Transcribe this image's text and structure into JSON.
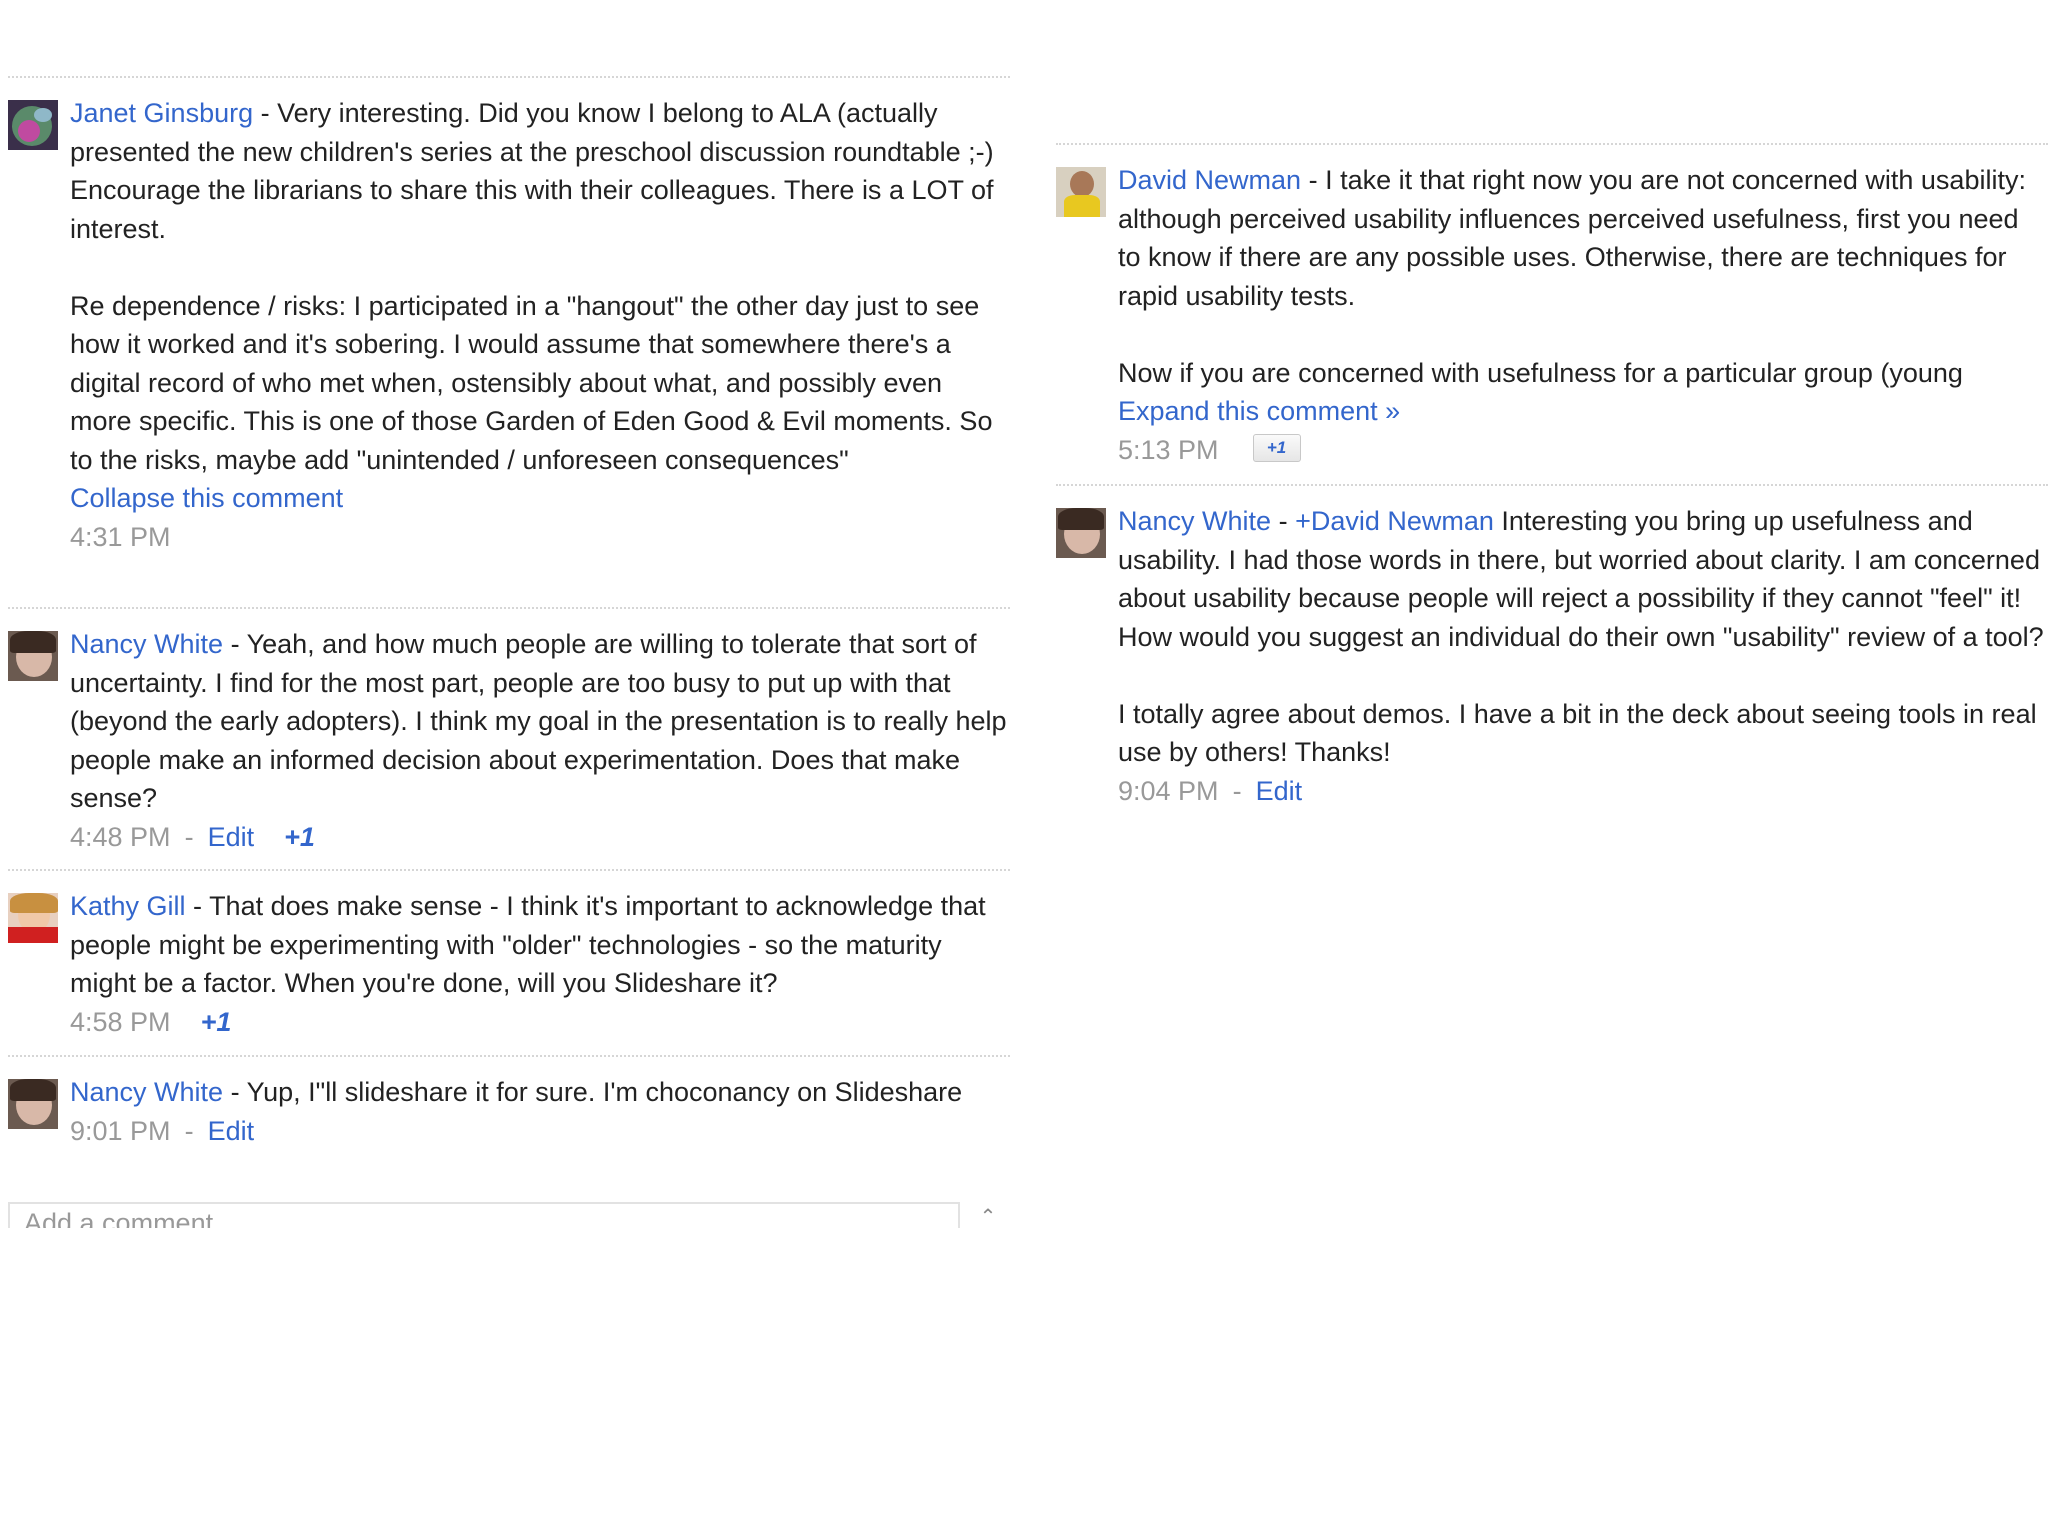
{
  "left_column": {
    "comments": [
      {
        "author": "Janet Ginsburg",
        "separator": " - ",
        "paragraphs": [
          "Very interesting. Did you know I belong to ALA (actually presented the new children's series at the preschool discussion roundtable ;-) Encourage the librarians to share this with their colleagues. There is a LOT of interest.",
          "Re dependence / risks: I participated in a \"hangout\" the other day just to see how it worked and it's sobering. I would assume that somewhere there's a digital record of who met when, ostensibly about what, and possibly even more specific. This is one of those Garden of Eden Good & Evil moments. So to the risks, maybe add \"unintended / unforeseen consequences\""
        ],
        "collapse_label": "Collapse this comment",
        "time": "4:31 PM"
      },
      {
        "author": "Nancy White",
        "separator": " - ",
        "text": "Yeah, and how much people are willing to tolerate that sort of uncertainty. I find for the most part, people are too busy to put up with that (beyond the early adopters). I think my goal in the presentation is to really help people make an informed decision about experimentation. Does that make sense?",
        "time": "4:48 PM",
        "meta_sep": "-",
        "edit_label": "Edit",
        "plus_one": "+1"
      },
      {
        "author": "Kathy Gill",
        "separator": " - ",
        "text": "That does make sense - I think it's important to acknowledge that people might be experimenting with \"older\" technologies - so the maturity might be a factor. When you're done, will you Slideshare it?",
        "time": "4:58 PM",
        "plus_one": "+1"
      },
      {
        "author": "Nancy White",
        "separator": " - ",
        "text": "Yup, I\"ll slideshare it for sure. I'm choconancy on Slideshare",
        "time": "9:01 PM",
        "meta_sep": "-",
        "edit_label": "Edit"
      }
    ],
    "add_comment": {
      "placeholder": "Add a comment..."
    }
  },
  "right_column": {
    "comments": [
      {
        "author": "David Newman",
        "separator": " - ",
        "paragraphs": [
          "I take it that right now you are not concerned with usability: although perceived usability influences perceived usefulness, first you need to know if there are any possible uses. Otherwise, there are techniques for rapid usability tests.",
          "Now if you are concerned with usefulness for a particular group (young"
        ],
        "expand_label": "Expand this comment »",
        "time": "5:13 PM",
        "plus_one": "+1"
      },
      {
        "author": "Nancy White",
        "separator": " - ",
        "mention": "+David Newman",
        "paragraphs": [
          " Interesting you bring up usefulness and usability. I had those words in there, but worried about clarity. I am concerned about usability because people will reject a possibility if they cannot \"feel\" it! How would you suggest an individual do their own \"usability\" review of a tool?",
          "I totally agree about demos. I have a bit in the deck about seeing tools in real use by others! Thanks!"
        ],
        "time": "9:04 PM",
        "meta_sep": "-",
        "edit_label": "Edit"
      }
    ]
  },
  "colors": {
    "link": "#3366cc",
    "text": "#222222",
    "muted": "#999999",
    "divider": "#d6d6d6"
  }
}
